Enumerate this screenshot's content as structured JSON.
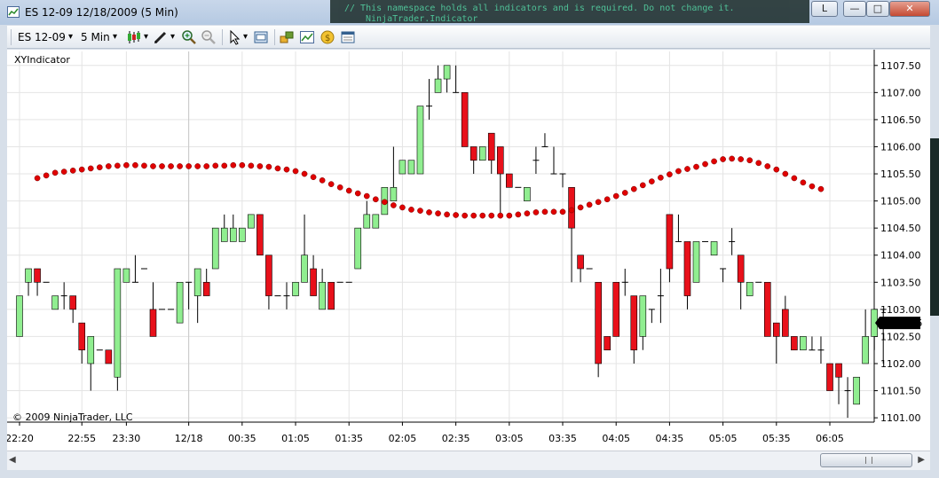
{
  "window": {
    "title": "ES 12-09  12/18/2009 (5 Min)",
    "background_text": "// This namespace holds all indicators and is required. Do not change it.",
    "background_text2": "NinjaTrader.Indicator",
    "layout_button": "L",
    "minimize_glyph": "—",
    "maximize_glyph": "□",
    "close_glyph": "✕"
  },
  "toolbar": {
    "instrument": "ES 12-09",
    "interval": "5 Min",
    "dropdown_glyph": "▾",
    "icons": [
      "candlestick-icon",
      "pencil-icon",
      "zoom-in-icon",
      "zoom-out-icon",
      "pointer-icon",
      "properties-icon",
      "strategy-icon",
      "indicator-icon",
      "coin-icon",
      "data-box-icon"
    ]
  },
  "chart": {
    "indicator_label": "XYIndicator",
    "copyright": "© 2009 NinjaTrader, LLC",
    "colors": {
      "up": "#90ee90",
      "down": "#e8101a",
      "indicator": "#e00000",
      "grid": "#e4e4e4",
      "last_price_bg": "#000000"
    },
    "last_price": "1102.75"
  },
  "chart_data": {
    "type": "candlestick",
    "y_ticks": [
      "1101.00",
      "1101.50",
      "1102.00",
      "1102.50",
      "1103.00",
      "1103.50",
      "1104.00",
      "1104.50",
      "1105.00",
      "1105.50",
      "1106.00",
      "1106.50",
      "1107.00",
      "1107.50"
    ],
    "ylim": [
      1100.92,
      1107.66
    ],
    "x_ticks": [
      {
        "label": "22:20",
        "bar": 0
      },
      {
        "label": "22:55",
        "bar": 7
      },
      {
        "label": "23:30",
        "bar": 12
      },
      {
        "label": "12/18",
        "bar": 19
      },
      {
        "label": "00:35",
        "bar": 25
      },
      {
        "label": "01:05",
        "bar": 31
      },
      {
        "label": "01:35",
        "bar": 37
      },
      {
        "label": "02:05",
        "bar": 43
      },
      {
        "label": "02:35",
        "bar": 49
      },
      {
        "label": "03:05",
        "bar": 55
      },
      {
        "label": "03:35",
        "bar": 61
      },
      {
        "label": "04:05",
        "bar": 67
      },
      {
        "label": "04:35",
        "bar": 73
      },
      {
        "label": "05:05",
        "bar": 79
      },
      {
        "label": "05:35",
        "bar": 85
      },
      {
        "label": "06:05",
        "bar": 91
      }
    ],
    "candles": [
      [
        1102.5,
        1103.25,
        1102.5,
        1103.25
      ],
      [
        1103.5,
        1103.75,
        1103.25,
        1103.75
      ],
      [
        1103.75,
        1103.75,
        1103.25,
        1103.5
      ],
      [
        1103.5,
        1103.5,
        1103.5,
        1103.5
      ],
      [
        1103.0,
        1103.25,
        1103.0,
        1103.25
      ],
      [
        1103.25,
        1103.5,
        1103.0,
        1103.25
      ],
      [
        1103.25,
        1103.25,
        1102.75,
        1103.0
      ],
      [
        1102.75,
        1102.75,
        1102.0,
        1102.25
      ],
      [
        1102.0,
        1102.5,
        1101.5,
        1102.5
      ],
      [
        1102.25,
        1102.25,
        1102.25,
        1102.25
      ],
      [
        1102.25,
        1102.25,
        1102.0,
        1102.0
      ],
      [
        1101.75,
        1103.75,
        1101.5,
        1103.75
      ],
      [
        1103.5,
        1103.75,
        1103.5,
        1103.75
      ],
      [
        1103.5,
        1104.0,
        1103.5,
        1103.5
      ],
      [
        1103.75,
        1103.75,
        1103.75,
        1103.75
      ],
      [
        1103.0,
        1103.5,
        1102.5,
        1102.5
      ],
      [
        1103.0,
        1103.0,
        1103.0,
        1103.0
      ],
      [
        1103.0,
        1103.0,
        1103.0,
        1103.0
      ],
      [
        1102.75,
        1103.5,
        1102.75,
        1103.5
      ],
      [
        1103.5,
        1103.5,
        1103.0,
        1103.5
      ],
      [
        1103.25,
        1103.75,
        1102.75,
        1103.75
      ],
      [
        1103.5,
        1103.75,
        1103.25,
        1103.25
      ],
      [
        1103.75,
        1104.5,
        1103.75,
        1104.5
      ],
      [
        1104.25,
        1104.75,
        1104.25,
        1104.5
      ],
      [
        1104.25,
        1104.75,
        1104.25,
        1104.5
      ],
      [
        1104.25,
        1104.5,
        1104.25,
        1104.5
      ],
      [
        1104.5,
        1104.75,
        1104.5,
        1104.75
      ],
      [
        1104.75,
        1104.75,
        1104.0,
        1104.0
      ],
      [
        1104.0,
        1104.0,
        1103.0,
        1103.25
      ],
      [
        1103.25,
        1103.25,
        1103.25,
        1103.25
      ],
      [
        1103.25,
        1103.5,
        1103.0,
        1103.25
      ],
      [
        1103.25,
        1103.5,
        1103.25,
        1103.5
      ],
      [
        1103.5,
        1104.75,
        1103.5,
        1104.0
      ],
      [
        1103.75,
        1104.0,
        1103.25,
        1103.25
      ],
      [
        1103.0,
        1103.75,
        1103.0,
        1103.5
      ],
      [
        1103.5,
        1103.5,
        1103.0,
        1103.0
      ],
      [
        1103.5,
        1103.5,
        1103.5,
        1103.5
      ],
      [
        1103.5,
        1103.5,
        1103.5,
        1103.5
      ],
      [
        1103.75,
        1104.5,
        1103.75,
        1104.5
      ],
      [
        1104.5,
        1105.0,
        1104.5,
        1104.75
      ],
      [
        1104.5,
        1104.75,
        1104.5,
        1104.75
      ],
      [
        1104.75,
        1105.25,
        1104.75,
        1105.25
      ],
      [
        1105.0,
        1106.0,
        1105.0,
        1105.25
      ],
      [
        1105.5,
        1105.75,
        1105.5,
        1105.75
      ],
      [
        1105.5,
        1105.75,
        1105.5,
        1105.75
      ],
      [
        1105.5,
        1106.75,
        1105.5,
        1106.75
      ],
      [
        1106.75,
        1107.25,
        1106.5,
        1106.75
      ],
      [
        1107.0,
        1107.5,
        1107.0,
        1107.25
      ],
      [
        1107.25,
        1107.5,
        1107.0,
        1107.5
      ],
      [
        1107.0,
        1107.5,
        1107.0,
        1107.0
      ],
      [
        1107.0,
        1107.0,
        1106.0,
        1106.0
      ],
      [
        1106.0,
        1106.0,
        1105.5,
        1105.75
      ],
      [
        1105.75,
        1106.0,
        1105.75,
        1106.0
      ],
      [
        1106.25,
        1106.25,
        1105.5,
        1105.75
      ],
      [
        1106.0,
        1106.0,
        1104.75,
        1105.5
      ],
      [
        1105.5,
        1105.5,
        1105.25,
        1105.25
      ],
      [
        1105.25,
        1105.25,
        1105.25,
        1105.25
      ],
      [
        1105.0,
        1105.25,
        1105.0,
        1105.25
      ],
      [
        1105.75,
        1106.0,
        1105.5,
        1105.75
      ],
      [
        1106.0,
        1106.25,
        1106.0,
        1106.0
      ],
      [
        1105.5,
        1106.0,
        1105.5,
        1105.5
      ],
      [
        1105.5,
        1105.5,
        1105.25,
        1105.5
      ],
      [
        1105.25,
        1105.25,
        1103.5,
        1104.5
      ],
      [
        1104.0,
        1104.0,
        1103.5,
        1103.75
      ],
      [
        1103.75,
        1103.75,
        1103.75,
        1103.75
      ],
      [
        1103.5,
        1103.5,
        1101.75,
        1102.0
      ],
      [
        1102.5,
        1102.5,
        1102.25,
        1102.25
      ],
      [
        1103.5,
        1103.5,
        1102.5,
        1102.5
      ],
      [
        1103.5,
        1103.75,
        1103.25,
        1103.5
      ],
      [
        1103.25,
        1103.25,
        1102.0,
        1102.25
      ],
      [
        1102.5,
        1103.25,
        1102.25,
        1103.25
      ],
      [
        1103.0,
        1103.0,
        1102.75,
        1103.0
      ],
      [
        1103.25,
        1103.75,
        1102.75,
        1103.25
      ],
      [
        1104.75,
        1104.75,
        1103.5,
        1103.75
      ],
      [
        1104.25,
        1104.75,
        1104.25,
        1104.25
      ],
      [
        1104.25,
        1104.25,
        1103.0,
        1103.25
      ],
      [
        1103.5,
        1104.25,
        1103.5,
        1104.25
      ],
      [
        1104.25,
        1104.25,
        1104.25,
        1104.25
      ],
      [
        1104.0,
        1104.25,
        1104.0,
        1104.25
      ],
      [
        1103.75,
        1103.75,
        1103.5,
        1103.75
      ],
      [
        1104.25,
        1104.5,
        1104.0,
        1104.25
      ],
      [
        1104.0,
        1104.0,
        1103.0,
        1103.5
      ],
      [
        1103.25,
        1103.5,
        1103.25,
        1103.5
      ],
      [
        1103.5,
        1103.5,
        1103.5,
        1103.5
      ],
      [
        1103.5,
        1103.5,
        1102.5,
        1102.5
      ],
      [
        1102.75,
        1102.75,
        1102.0,
        1102.5
      ],
      [
        1103.0,
        1103.25,
        1102.5,
        1102.5
      ],
      [
        1102.5,
        1102.5,
        1102.25,
        1102.25
      ],
      [
        1102.25,
        1102.5,
        1102.25,
        1102.5
      ],
      [
        1102.25,
        1102.5,
        1102.25,
        1102.25
      ],
      [
        1102.25,
        1102.5,
        1102.0,
        1102.25
      ],
      [
        1102.0,
        1102.0,
        1101.5,
        1101.5
      ],
      [
        1102.0,
        1102.0,
        1101.25,
        1101.75
      ],
      [
        1101.5,
        1101.75,
        1101.0,
        1101.5
      ],
      [
        1101.25,
        1101.75,
        1101.25,
        1101.75
      ],
      [
        1102.0,
        1103.0,
        1102.0,
        1102.5
      ],
      [
        1102.5,
        1103.0,
        1102.25,
        1103.0
      ],
      [
        1103.0,
        1103.0,
        1102.0,
        1103.0
      ]
    ],
    "indicator_first_bar": 2,
    "indicator": [
      1105.42,
      1105.47,
      1105.52,
      1105.54,
      1105.56,
      1105.58,
      1105.6,
      1105.62,
      1105.64,
      1105.65,
      1105.66,
      1105.66,
      1105.65,
      1105.64,
      1105.64,
      1105.64,
      1105.64,
      1105.64,
      1105.64,
      1105.64,
      1105.65,
      1105.65,
      1105.66,
      1105.66,
      1105.65,
      1105.64,
      1105.63,
      1105.6,
      1105.58,
      1105.55,
      1105.5,
      1105.44,
      1105.38,
      1105.31,
      1105.25,
      1105.19,
      1105.14,
      1105.09,
      1105.03,
      1104.98,
      1104.92,
      1104.88,
      1104.84,
      1104.82,
      1104.79,
      1104.77,
      1104.75,
      1104.74,
      1104.73,
      1104.73,
      1104.73,
      1104.73,
      1104.73,
      1104.73,
      1104.75,
      1104.77,
      1104.79,
      1104.8,
      1104.8,
      1104.8,
      1104.83,
      1104.88,
      1104.93,
      1104.98,
      1105.03,
      1105.09,
      1105.15,
      1105.22,
      1105.29,
      1105.36,
      1105.43,
      1105.49,
      1105.55,
      1105.59,
      1105.63,
      1105.68,
      1105.73,
      1105.77,
      1105.78,
      1105.77,
      1105.75,
      1105.7,
      1105.64,
      1105.58,
      1105.5,
      1105.42,
      1105.34,
      1105.27,
      1105.22
    ]
  }
}
